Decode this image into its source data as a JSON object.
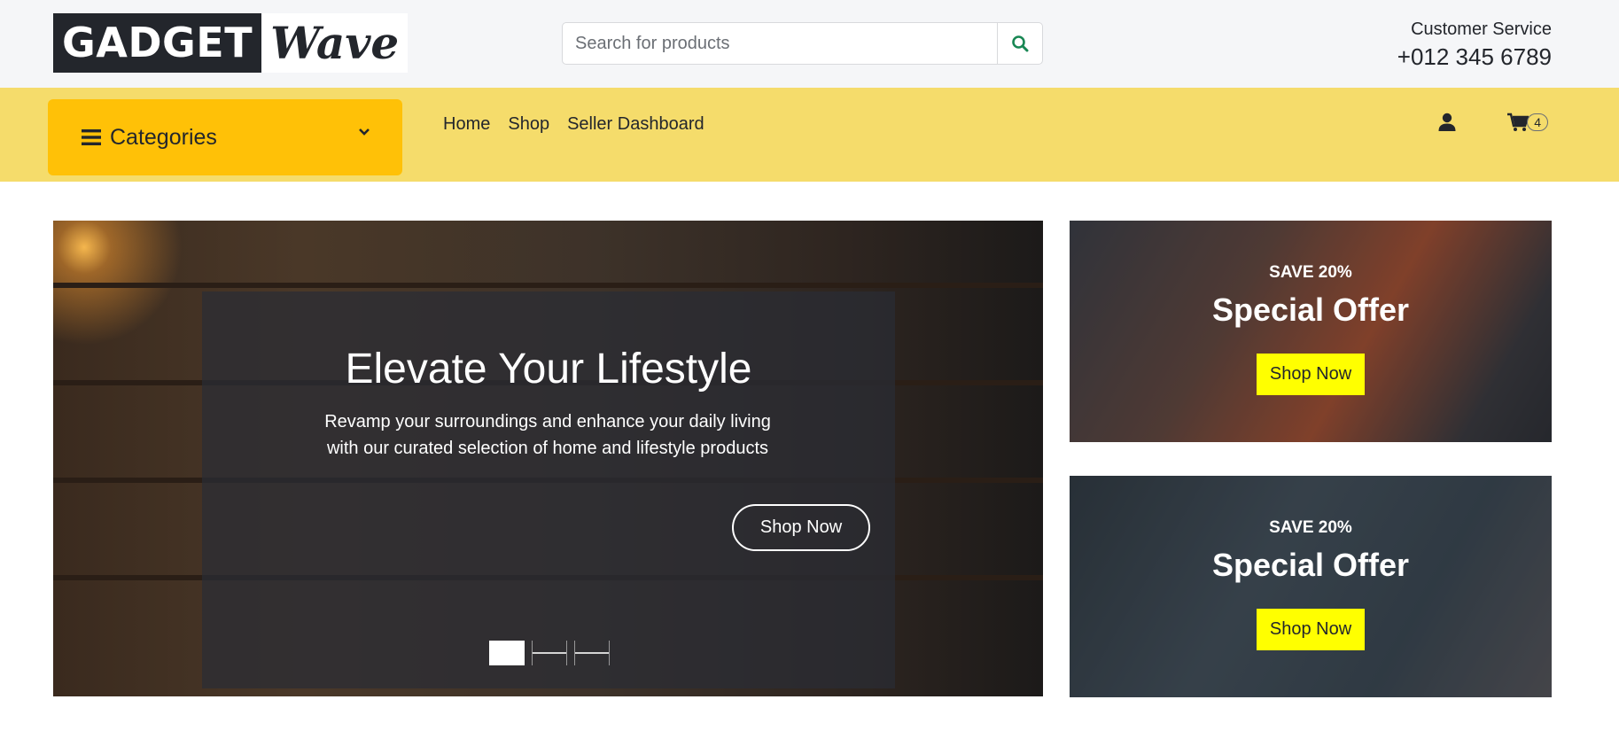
{
  "brand": {
    "part1": "GADGET",
    "part2": "Wave"
  },
  "search": {
    "placeholder": "Search for products",
    "value": ""
  },
  "service": {
    "label": "Customer Service",
    "phone": "+012 345 6789"
  },
  "nav": {
    "categories_label": "Categories",
    "links": [
      "Home",
      "Shop",
      "Seller Dashboard"
    ],
    "cart_count": "4"
  },
  "hero": {
    "title": "Elevate Your Lifestyle",
    "text": "Revamp your surroundings and enhance your daily living with our curated selection of home and lifestyle products",
    "button": "Shop Now",
    "active_slide": 1,
    "slide_count": 3
  },
  "offers": [
    {
      "sub": "SAVE 20%",
      "title": "Special Offer",
      "button": "Shop Now"
    },
    {
      "sub": "SAVE 20%",
      "title": "Special Offer",
      "button": "Shop Now"
    }
  ],
  "colors": {
    "topbar_bg": "#f5f6f8",
    "navbar_bg": "#f5dc6b",
    "categories_bg": "#ffc107",
    "offer_button": "#ffff00",
    "search_icon": "#198754",
    "text_dark": "#23262c"
  },
  "icons": [
    "search-icon",
    "bars-icon",
    "chevron-down-icon",
    "user-icon",
    "cart-icon"
  ]
}
